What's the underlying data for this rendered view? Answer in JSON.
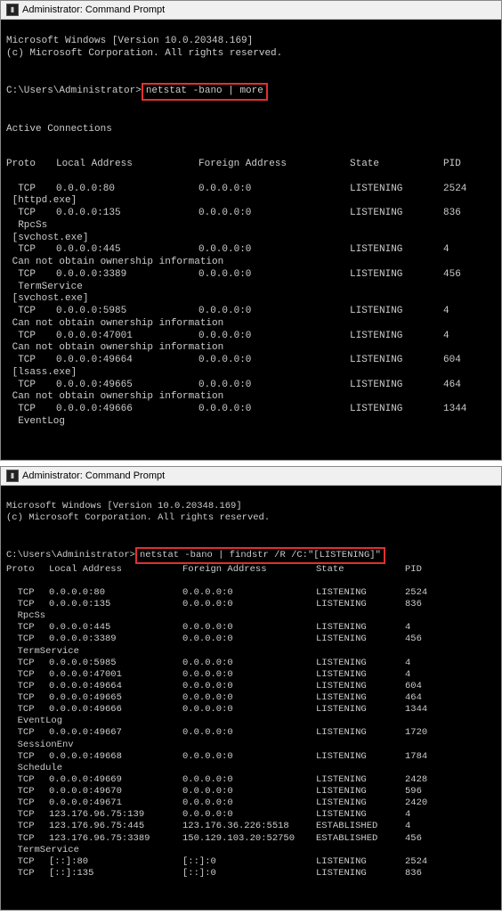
{
  "window1": {
    "title": "Administrator: Command Prompt",
    "banner_line1": "Microsoft Windows [Version 10.0.20348.169]",
    "banner_line2": "(c) Microsoft Corporation. All rights reserved.",
    "prompt": "C:\\Users\\Administrator>",
    "command": "netstat -bano | more",
    "heading": "Active Connections",
    "columns": {
      "proto": "Proto",
      "local": "Local Address",
      "foreign": "Foreign Address",
      "state": "State",
      "pid": "PID"
    },
    "lines": [
      {
        "type": "row",
        "proto": "TCP",
        "local": "0.0.0.0:80",
        "foreign": "0.0.0.0:0",
        "state": "LISTENING",
        "pid": "2524"
      },
      {
        "type": "owner",
        "text": " [httpd.exe]"
      },
      {
        "type": "row",
        "proto": "TCP",
        "local": "0.0.0.0:135",
        "foreign": "0.0.0.0:0",
        "state": "LISTENING",
        "pid": "836"
      },
      {
        "type": "owner",
        "text": "  RpcSs"
      },
      {
        "type": "owner",
        "text": " [svchost.exe]"
      },
      {
        "type": "row",
        "proto": "TCP",
        "local": "0.0.0.0:445",
        "foreign": "0.0.0.0:0",
        "state": "LISTENING",
        "pid": "4"
      },
      {
        "type": "owner",
        "text": " Can not obtain ownership information"
      },
      {
        "type": "row",
        "proto": "TCP",
        "local": "0.0.0.0:3389",
        "foreign": "0.0.0.0:0",
        "state": "LISTENING",
        "pid": "456"
      },
      {
        "type": "owner",
        "text": "  TermService"
      },
      {
        "type": "owner",
        "text": " [svchost.exe]"
      },
      {
        "type": "row",
        "proto": "TCP",
        "local": "0.0.0.0:5985",
        "foreign": "0.0.0.0:0",
        "state": "LISTENING",
        "pid": "4"
      },
      {
        "type": "owner",
        "text": " Can not obtain ownership information"
      },
      {
        "type": "row",
        "proto": "TCP",
        "local": "0.0.0.0:47001",
        "foreign": "0.0.0.0:0",
        "state": "LISTENING",
        "pid": "4"
      },
      {
        "type": "owner",
        "text": " Can not obtain ownership information"
      },
      {
        "type": "row",
        "proto": "TCP",
        "local": "0.0.0.0:49664",
        "foreign": "0.0.0.0:0",
        "state": "LISTENING",
        "pid": "604"
      },
      {
        "type": "owner",
        "text": " [lsass.exe]"
      },
      {
        "type": "row",
        "proto": "TCP",
        "local": "0.0.0.0:49665",
        "foreign": "0.0.0.0:0",
        "state": "LISTENING",
        "pid": "464"
      },
      {
        "type": "owner",
        "text": " Can not obtain ownership information"
      },
      {
        "type": "row",
        "proto": "TCP",
        "local": "0.0.0.0:49666",
        "foreign": "0.0.0.0:0",
        "state": "LISTENING",
        "pid": "1344"
      },
      {
        "type": "owner",
        "text": "  EventLog"
      }
    ]
  },
  "window2": {
    "title": "Administrator: Command Prompt",
    "banner_line1": "Microsoft Windows [Version 10.0.20348.169]",
    "banner_line2": "(c) Microsoft Corporation. All rights reserved.",
    "prompt": "C:\\Users\\Administrator>",
    "command": "netstat -bano | findstr /R /C:\"[LISTENING]\"",
    "columns": {
      "proto": "Proto",
      "local": "Local Address",
      "foreign": "Foreign Address",
      "state": "State",
      "pid": "PID"
    },
    "lines": [
      {
        "type": "row",
        "proto": "TCP",
        "local": "0.0.0.0:80",
        "foreign": "0.0.0.0:0",
        "state": "LISTENING",
        "pid": "2524"
      },
      {
        "type": "row",
        "proto": "TCP",
        "local": "0.0.0.0:135",
        "foreign": "0.0.0.0:0",
        "state": "LISTENING",
        "pid": "836"
      },
      {
        "type": "owner",
        "text": "  RpcSs"
      },
      {
        "type": "row",
        "proto": "TCP",
        "local": "0.0.0.0:445",
        "foreign": "0.0.0.0:0",
        "state": "LISTENING",
        "pid": "4"
      },
      {
        "type": "row",
        "proto": "TCP",
        "local": "0.0.0.0:3389",
        "foreign": "0.0.0.0:0",
        "state": "LISTENING",
        "pid": "456"
      },
      {
        "type": "owner",
        "text": "  TermService"
      },
      {
        "type": "row",
        "proto": "TCP",
        "local": "0.0.0.0:5985",
        "foreign": "0.0.0.0:0",
        "state": "LISTENING",
        "pid": "4"
      },
      {
        "type": "row",
        "proto": "TCP",
        "local": "0.0.0.0:47001",
        "foreign": "0.0.0.0:0",
        "state": "LISTENING",
        "pid": "4"
      },
      {
        "type": "row",
        "proto": "TCP",
        "local": "0.0.0.0:49664",
        "foreign": "0.0.0.0:0",
        "state": "LISTENING",
        "pid": "604"
      },
      {
        "type": "row",
        "proto": "TCP",
        "local": "0.0.0.0:49665",
        "foreign": "0.0.0.0:0",
        "state": "LISTENING",
        "pid": "464"
      },
      {
        "type": "row",
        "proto": "TCP",
        "local": "0.0.0.0:49666",
        "foreign": "0.0.0.0:0",
        "state": "LISTENING",
        "pid": "1344"
      },
      {
        "type": "owner",
        "text": "  EventLog"
      },
      {
        "type": "row",
        "proto": "TCP",
        "local": "0.0.0.0:49667",
        "foreign": "0.0.0.0:0",
        "state": "LISTENING",
        "pid": "1720"
      },
      {
        "type": "owner",
        "text": "  SessionEnv"
      },
      {
        "type": "row",
        "proto": "TCP",
        "local": "0.0.0.0:49668",
        "foreign": "0.0.0.0:0",
        "state": "LISTENING",
        "pid": "1784"
      },
      {
        "type": "owner",
        "text": "  Schedule"
      },
      {
        "type": "row",
        "proto": "TCP",
        "local": "0.0.0.0:49669",
        "foreign": "0.0.0.0:0",
        "state": "LISTENING",
        "pid": "2428"
      },
      {
        "type": "row",
        "proto": "TCP",
        "local": "0.0.0.0:49670",
        "foreign": "0.0.0.0:0",
        "state": "LISTENING",
        "pid": "596"
      },
      {
        "type": "row",
        "proto": "TCP",
        "local": "0.0.0.0:49671",
        "foreign": "0.0.0.0:0",
        "state": "LISTENING",
        "pid": "2420"
      },
      {
        "type": "row",
        "proto": "TCP",
        "local": "123.176.96.75:139",
        "foreign": "0.0.0.0:0",
        "state": "LISTENING",
        "pid": "4"
      },
      {
        "type": "row",
        "proto": "TCP",
        "local": "123.176.96.75:445",
        "foreign": "123.176.36.226:5518",
        "state": "ESTABLISHED",
        "pid": "4"
      },
      {
        "type": "row",
        "proto": "TCP",
        "local": "123.176.96.75:3389",
        "foreign": "150.129.103.20:52750",
        "state": "ESTABLISHED",
        "pid": "456"
      },
      {
        "type": "owner",
        "text": "  TermService"
      },
      {
        "type": "row",
        "proto": "TCP",
        "local": "[::]:80",
        "foreign": "[::]:0",
        "state": "LISTENING",
        "pid": "2524"
      },
      {
        "type": "row",
        "proto": "TCP",
        "local": "[::]:135",
        "foreign": "[::]:0",
        "state": "LISTENING",
        "pid": "836"
      }
    ]
  }
}
